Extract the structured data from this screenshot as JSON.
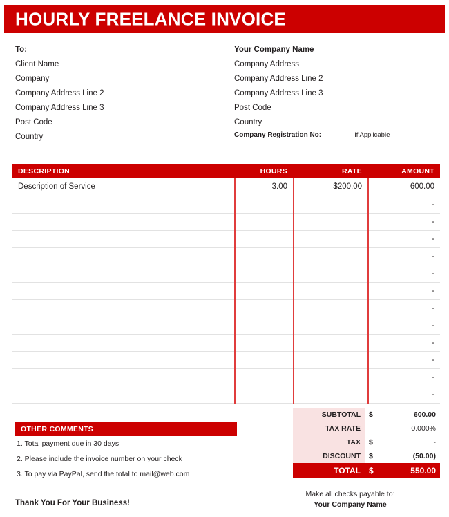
{
  "theme": {
    "accent_red": "#CC0000",
    "totals_label_bg": "#F9E2E2",
    "row_border": "#E2E2E2",
    "text": "#231F20"
  },
  "header": {
    "title": "HOURLY FREELANCE INVOICE"
  },
  "bill_to": {
    "heading": "To:",
    "lines": [
      "Client Name",
      "Company",
      "Company Address Line 2",
      "Company Address Line 3",
      "Post Code",
      "Country"
    ]
  },
  "company": {
    "name": "Your Company Name",
    "lines": [
      "Company Address",
      "Company Address Line 2",
      "Company Address Line 3",
      "Post Code",
      "Country"
    ],
    "registration_label": "Company Registration No:",
    "registration_value": "If Applicable"
  },
  "items_table": {
    "headers": {
      "description": "DESCRIPTION",
      "hours": "HOURS",
      "rate": "RATE",
      "amount": "AMOUNT"
    },
    "rows": [
      {
        "description": "Description of Service",
        "hours": "3.00",
        "rate": "$200.00",
        "amount": "600.00"
      },
      {
        "description": "",
        "hours": "",
        "rate": "",
        "amount": "-"
      },
      {
        "description": "",
        "hours": "",
        "rate": "",
        "amount": "-"
      },
      {
        "description": "",
        "hours": "",
        "rate": "",
        "amount": "-"
      },
      {
        "description": "",
        "hours": "",
        "rate": "",
        "amount": "-"
      },
      {
        "description": "",
        "hours": "",
        "rate": "",
        "amount": "-"
      },
      {
        "description": "",
        "hours": "",
        "rate": "",
        "amount": "-"
      },
      {
        "description": "",
        "hours": "",
        "rate": "",
        "amount": "-"
      },
      {
        "description": "",
        "hours": "",
        "rate": "",
        "amount": "-"
      },
      {
        "description": "",
        "hours": "",
        "rate": "",
        "amount": "-"
      },
      {
        "description": "",
        "hours": "",
        "rate": "",
        "amount": "-"
      },
      {
        "description": "",
        "hours": "",
        "rate": "",
        "amount": "-"
      },
      {
        "description": "",
        "hours": "",
        "rate": "",
        "amount": "-"
      }
    ]
  },
  "comments": {
    "heading": "OTHER COMMENTS",
    "lines": [
      "1. Total payment due in 30 days",
      "2. Please include the invoice number on your check",
      "3. To pay via PayPal, send the total to mail@web.com"
    ]
  },
  "totals": {
    "subtotal": {
      "label": "SUBTOTAL",
      "currency": "$",
      "value": "600.00"
    },
    "tax_rate": {
      "label": "TAX RATE",
      "currency": "",
      "value": "0.000%"
    },
    "tax": {
      "label": "TAX",
      "currency": "$",
      "value": "-"
    },
    "discount": {
      "label": "DISCOUNT",
      "currency": "$",
      "value": "(50.00)"
    },
    "total": {
      "label": "TOTAL",
      "currency": "$",
      "value": "550.00"
    }
  },
  "footer": {
    "thanks": "Thank You For Your Business!",
    "payable_label": "Make all checks payable to:",
    "payable_name": "Your Company Name"
  }
}
